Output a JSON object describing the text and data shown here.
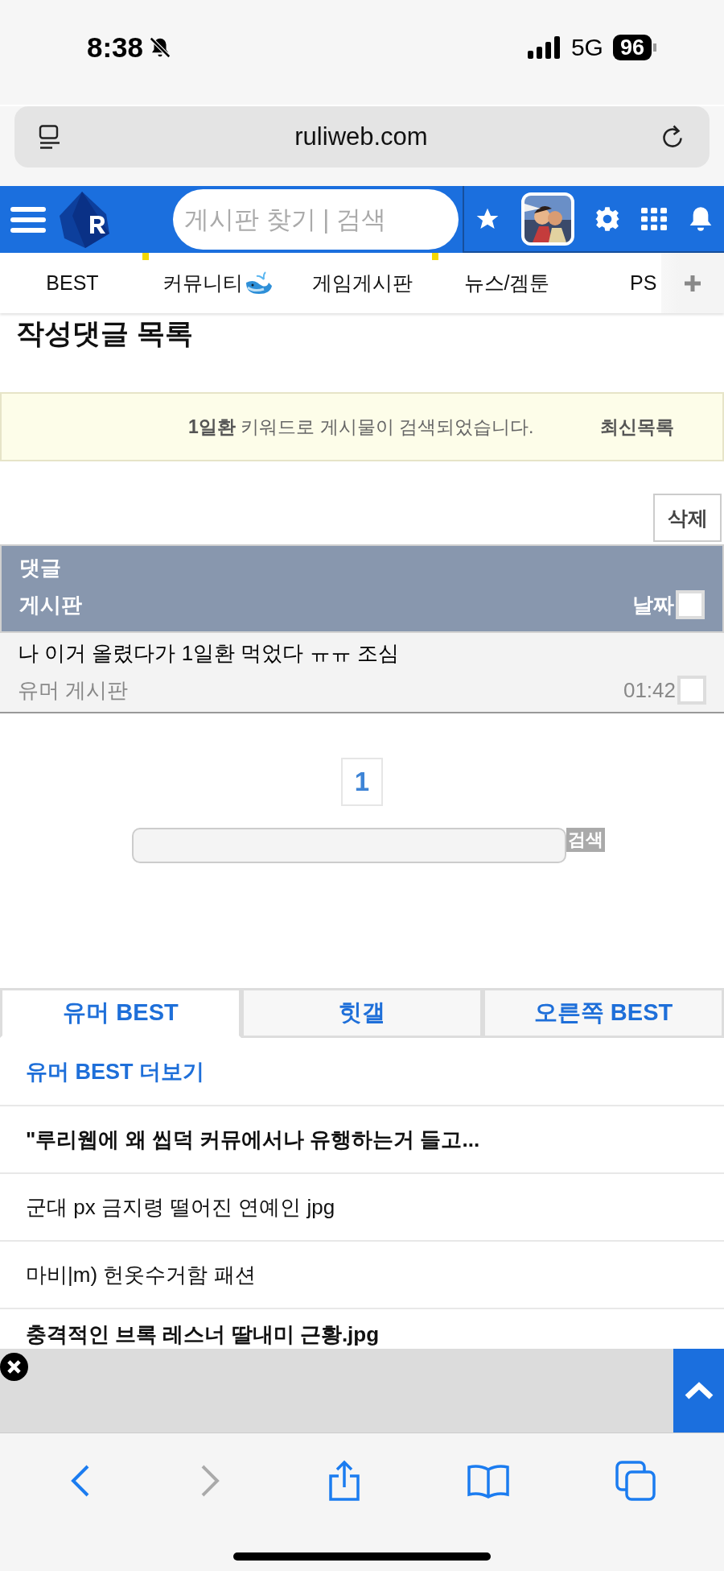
{
  "status_bar": {
    "time": "8:38",
    "network": "5G",
    "battery": "96"
  },
  "browser": {
    "url": "ruliweb.com"
  },
  "header": {
    "search": {
      "placeholder": "게시판 찾기 | 검색"
    }
  },
  "nav": {
    "items": [
      {
        "label": "BEST",
        "new_mark": true,
        "kind": "text"
      },
      {
        "label": "커뮤니티",
        "new_mark": false,
        "kind": "whale"
      },
      {
        "label": "게임게시판",
        "new_mark": true,
        "kind": "text"
      },
      {
        "label": "뉴스/겜툰",
        "new_mark": false,
        "kind": "text"
      },
      {
        "label": "PS",
        "new_mark": false,
        "kind": "text"
      }
    ]
  },
  "page": {
    "title": "작성댓글 목록",
    "notice": {
      "text": "**1일환** 키워드로 게시물이 검색되었습니다.",
      "link": "최신목록"
    },
    "delete_button": "삭제",
    "table": {
      "columns": [
        "댓글",
        "게시판",
        "날짜"
      ],
      "select_all": {
        "checked": false
      },
      "rows": [
        {
          "comment": "나 이거 올렸다가 1일환 먹었다 ㅠㅠ 조심",
          "board": "유머 게시판",
          "time": "01:42",
          "checked": false
        }
      ]
    },
    "pagination": [
      {
        "label": "1",
        "selected": true
      }
    ],
    "search": {
      "button": "검색"
    }
  },
  "best": {
    "tabs": [
      {
        "label": "유머 BEST",
        "selected": true
      },
      {
        "label": "힛갤",
        "selected": false
      },
      {
        "label": "오른쪽 BEST",
        "selected": false
      }
    ],
    "more_link": "유머 BEST 더보기",
    "items": [
      {
        "title": "\"루리웹에 왜 씹덕 커뮤에서나 유행하는거 들고...",
        "emphasized": true
      },
      {
        "title": "군대 px 금지령 떨어진 연예인 jpg",
        "emphasized": false
      },
      {
        "title": "마비|m) 헌옷수거함 패션",
        "emphasized": false
      },
      {
        "title": "충격적인 브록 레스너 딸내미 근황.jpg",
        "emphasized": true
      }
    ]
  }
}
